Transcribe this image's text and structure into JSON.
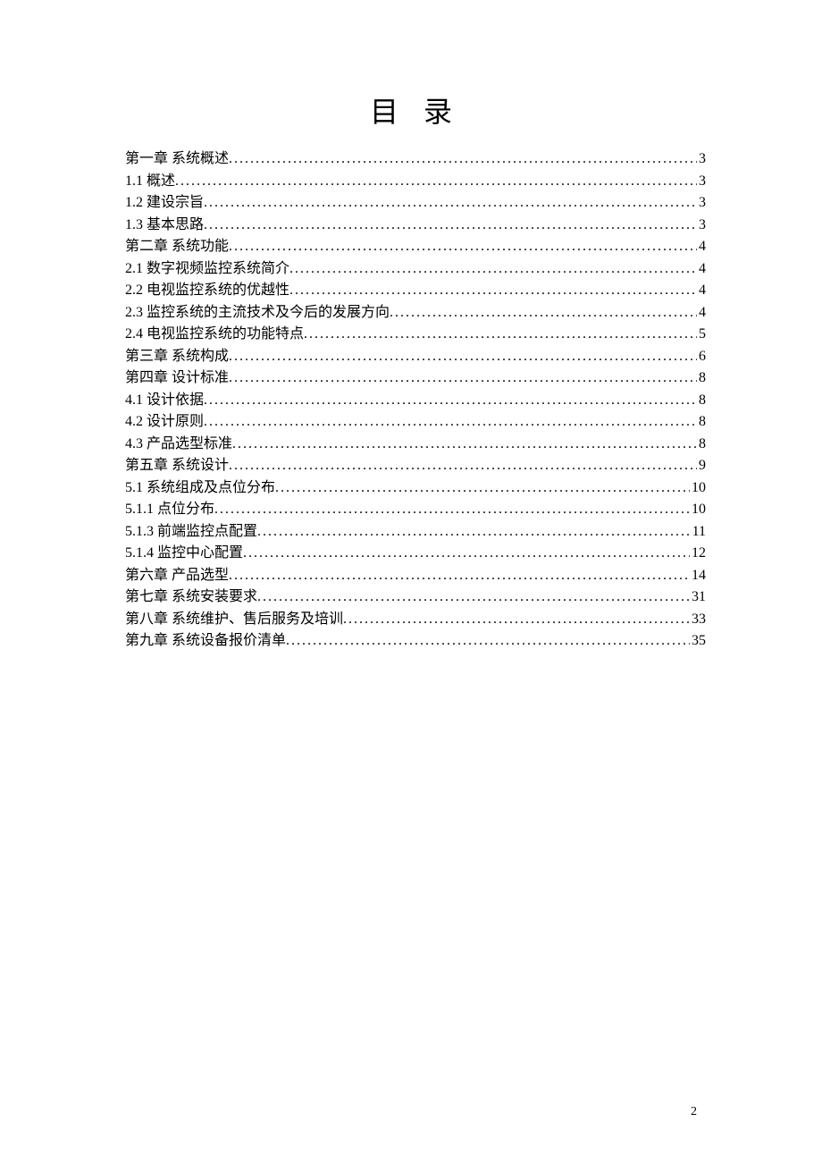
{
  "title": "目 录",
  "page_number": "2",
  "toc": [
    {
      "label": "第一章 系统概述",
      "page": "3"
    },
    {
      "label": "1.1 概述",
      "page": "3"
    },
    {
      "label": "1.2 建设宗旨",
      "page": "3"
    },
    {
      "label": "1.3 基本思路",
      "page": "3"
    },
    {
      "label": "第二章 系统功能",
      "page": "4"
    },
    {
      "label": "2.1 数字视频监控系统简介",
      "page": "4"
    },
    {
      "label": "2.2 电视监控系统的优越性",
      "page": "4"
    },
    {
      "label": "2.3 监控系统的主流技术及今后的发展方向",
      "page": "4"
    },
    {
      "label": "2.4 电视监控系统的功能特点",
      "page": "5"
    },
    {
      "label": "第三章 系统构成",
      "page": "6"
    },
    {
      "label": "第四章 设计标准",
      "page": "8"
    },
    {
      "label": "4.1 设计依据",
      "page": "8"
    },
    {
      "label": "4.2 设计原则",
      "page": "8"
    },
    {
      "label": "4.3 产品选型标准",
      "page": "8"
    },
    {
      "label": "第五章 系统设计",
      "page": "9"
    },
    {
      "label": "5.1 系统组成及点位分布",
      "page": "10"
    },
    {
      "label": "5.1.1 点位分布",
      "page": "10"
    },
    {
      "label": "5.1.3 前端监控点配置",
      "page": "11"
    },
    {
      "label": "5.1.4 监控中心配置",
      "page": "12"
    },
    {
      "label": "第六章 产品选型",
      "page": "14"
    },
    {
      "label": "第七章 系统安装要求",
      "page": "31"
    },
    {
      "label": "第八章 系统维护、售后服务及培训",
      "page": "33"
    },
    {
      "label": "第九章 系统设备报价清单",
      "page": "35"
    }
  ]
}
